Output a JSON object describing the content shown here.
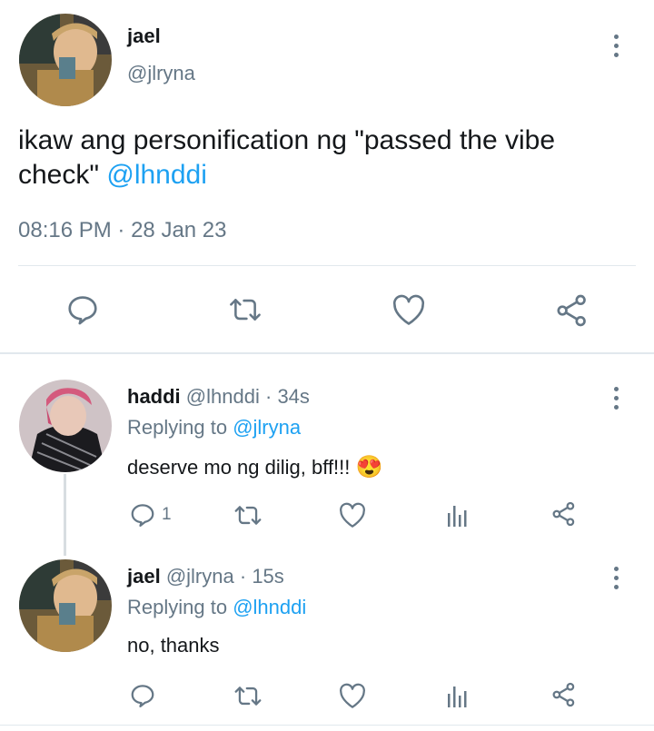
{
  "main_tweet": {
    "name": "jael",
    "handle": "@jlryna",
    "text": "ikaw ang personification ng \"passed the vibe check\"",
    "mention": "@lhnddi",
    "time": "08:16 PM",
    "date": "28 Jan 23",
    "separator": "·"
  },
  "replies": [
    {
      "name": "haddi",
      "handle": "@lhnddi",
      "age": "34s",
      "replying_label": "Replying to",
      "replying_to": "@jlryna",
      "text": "deserve mo ng dilig, bff!!!",
      "emoji": "😍",
      "reply_count": "1"
    },
    {
      "name": "jael",
      "handle": "@jlryna",
      "age": "15s",
      "replying_label": "Replying to",
      "replying_to": "@lhnddi",
      "text": "no, thanks"
    }
  ],
  "colors": {
    "accent": "#1da1f2",
    "muted": "#657786",
    "divider": "#e1e8ed"
  },
  "icons": [
    "more-vertical-icon",
    "reply-icon",
    "retweet-icon",
    "like-icon",
    "share-icon",
    "analytics-icon"
  ]
}
